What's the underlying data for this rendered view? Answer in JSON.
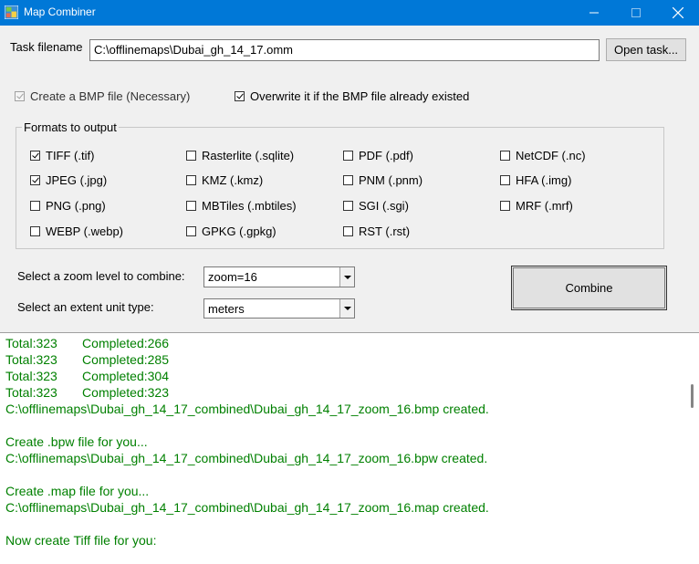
{
  "window": {
    "title": "Map Combiner"
  },
  "task": {
    "label": "Task filename",
    "value": "C:\\offlinemaps\\Dubai_gh_14_17.omm",
    "open_button": "Open task..."
  },
  "options": {
    "create_bmp": {
      "label": "Create a  BMP file (Necessary)",
      "checked": true,
      "disabled": true
    },
    "overwrite": {
      "label": "Overwrite it if the BMP file already existed",
      "checked": true
    }
  },
  "formats": {
    "group_label": "Formats to output",
    "items": [
      {
        "label": "TIFF (.tif)",
        "checked": true
      },
      {
        "label": "Rasterlite (.sqlite)",
        "checked": false
      },
      {
        "label": "PDF (.pdf)",
        "checked": false
      },
      {
        "label": "NetCDF (.nc)",
        "checked": false
      },
      {
        "label": "JPEG (.jpg)",
        "checked": true
      },
      {
        "label": "KMZ (.kmz)",
        "checked": false
      },
      {
        "label": "PNM (.pnm)",
        "checked": false
      },
      {
        "label": "HFA (.img)",
        "checked": false
      },
      {
        "label": "PNG (.png)",
        "checked": false
      },
      {
        "label": "MBTiles (.mbtiles)",
        "checked": false
      },
      {
        "label": "SGI (.sgi)",
        "checked": false
      },
      {
        "label": "MRF (.mrf)",
        "checked": false
      },
      {
        "label": "WEBP (.webp)",
        "checked": false
      },
      {
        "label": "GPKG (.gpkg)",
        "checked": false
      },
      {
        "label": "RST (.rst)",
        "checked": false
      }
    ]
  },
  "zoom": {
    "label": "Select a zoom level to combine:",
    "value": "zoom=16"
  },
  "extent": {
    "label": "Select an extent unit type:",
    "value": "meters"
  },
  "combine_button": "Combine",
  "log": {
    "color": "#008000",
    "lines": [
      "Total:323       Completed:266",
      "Total:323       Completed:285",
      "Total:323       Completed:304",
      "Total:323       Completed:323",
      "C:\\offlinemaps\\Dubai_gh_14_17_combined\\Dubai_gh_14_17_zoom_16.bmp created.",
      "",
      "Create .bpw file for you...",
      "C:\\offlinemaps\\Dubai_gh_14_17_combined\\Dubai_gh_14_17_zoom_16.bpw created.",
      "",
      "Create .map file for you...",
      "C:\\offlinemaps\\Dubai_gh_14_17_combined\\Dubai_gh_14_17_zoom_16.map created.",
      "",
      "Now create Tiff file for you:"
    ]
  }
}
